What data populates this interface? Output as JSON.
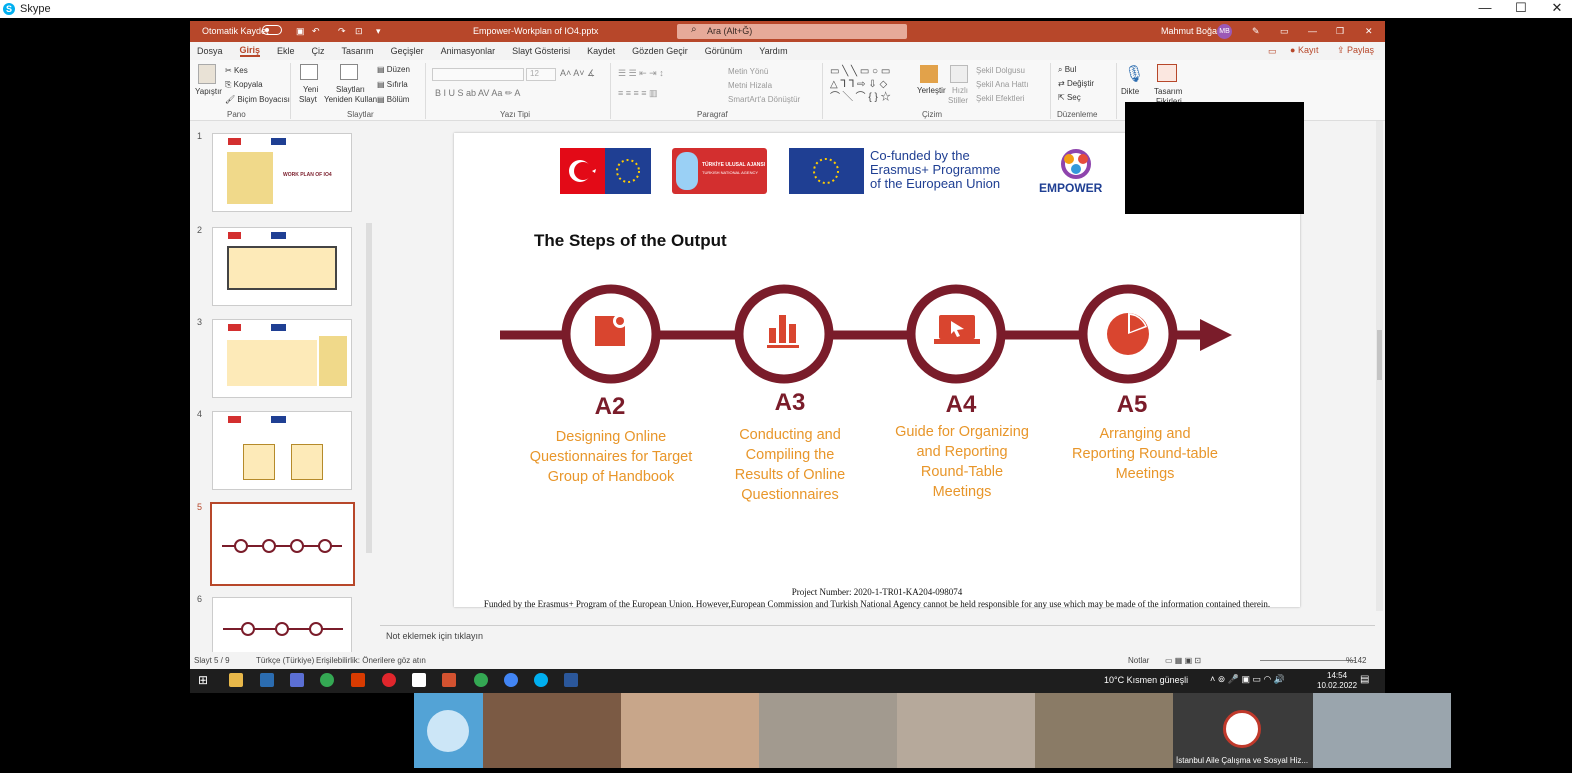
{
  "skype": {
    "title": "Skype",
    "logo": "S",
    "minimize": "—",
    "maximize": "☐",
    "close": "✕"
  },
  "ppt": {
    "autosave": "Otomatik Kaydet",
    "file_name": "Empower-Workplan of IO4.pptx",
    "search_placeholder": "Ara (Alt+Ğ)",
    "user_name": "Mahmut Boğaz",
    "user_initials": "MB",
    "kayit": "Kayıt",
    "paylas": "Paylaş",
    "menu": [
      "Dosya",
      "Giriş",
      "Ekle",
      "Çiz",
      "Tasarım",
      "Geçişler",
      "Animasyonlar",
      "Slayt Gösterisi",
      "Kaydet",
      "Gözden Geçir",
      "Görünüm",
      "Yardım"
    ],
    "ribbon": {
      "yapistir": "Yapıştır",
      "kes": "Kes",
      "kopyala": "Kopyala",
      "bicim": "Biçim Boyacısı",
      "pano": "Pano",
      "yeni_slayt": "Yeni",
      "yeni_slayt2": "Slayt",
      "slaytlari": "Slaytları",
      "yeniden": "Yeniden Kullan",
      "duzen": "Düzen",
      "sifirla": "Sıfırla",
      "bolum": "Bölüm",
      "slaytlar": "Slaytlar",
      "font_size": "12",
      "yazi_tipi": "Yazı Tipi",
      "metin_yonu": "Metin Yönü",
      "metni_hizala": "Metni Hizala",
      "smartart": "SmartArt'a Dönüştür",
      "paragraf": "Paragraf",
      "verlestir": "Yerleştir",
      "hizli": "Hızlı",
      "stiller": "Stiller",
      "sekil_dolgusu": "Şekil Dolgusu",
      "sekil_ana": "Şekil Ana Hattı",
      "sekil_efekt": "Şekil Efektleri",
      "cizim": "Çizim",
      "bul": "Bul",
      "degistir": "Değiştir",
      "sec": "Seç",
      "duzenleme": "Düzenleme",
      "dikte": "Dikte",
      "tasarim": "Tasarım",
      "fikirleri": "Fikirleri"
    },
    "thumb_numbers": [
      "1",
      "2",
      "3",
      "4",
      "5",
      "6"
    ],
    "thumb1_title": "WORK PLAN OF IO4",
    "notes_placeholder": "Not eklemek için tıklayın",
    "status": {
      "slide": "Slayt 5 / 9",
      "lang": "Türkçe (Türkiye)",
      "access": "Erişilebilirlik: Önerilere göz atın",
      "notlar": "Notlar",
      "zoom": "%142"
    }
  },
  "slide": {
    "ua_label": "TÜRKİYE ULUSAL AJANSI",
    "ua_sub": "TURKISH NATIONAL AGENCY",
    "cofund": [
      "Co-funded by the",
      "Erasmus+ Programme",
      "of the European Union"
    ],
    "empower": "EMPOWER",
    "title": "The Steps of the Output",
    "steps": [
      {
        "code": "A2",
        "desc": [
          "Designing Online",
          "Questionnaires for Target",
          "Group of Handbook"
        ]
      },
      {
        "code": "A3",
        "desc": [
          "Conducting and",
          "Compiling the",
          "Results of Online",
          "Questionnaires"
        ]
      },
      {
        "code": "A4",
        "desc": [
          "Guide for Organizing",
          "and Reporting",
          "Round-Table",
          "Meetings"
        ]
      },
      {
        "code": "A5",
        "desc": [
          "Arranging and",
          "Reporting Round-table",
          "Meetings"
        ]
      }
    ],
    "project_number": "Project Number: 2020-1-TR01-KA204-098074",
    "funded": "Funded by the Erasmus+ Program of the European Union. However,European Commission and Turkish National Agency cannot be held responsible for any use which may be made of the information contained therein."
  },
  "taskbar": {
    "weather": "10°C  Kısmen güneşli",
    "time": "14:54",
    "date": "10.02.2022"
  },
  "video": {
    "last_label": "İstanbul Aile Çalışma ve Sosyal Hiz..."
  },
  "colors": {
    "ppt_accent": "#b7472a",
    "maroon": "#7a1c2a",
    "orange": "#e8962a",
    "icon_red": "#d9452f"
  }
}
